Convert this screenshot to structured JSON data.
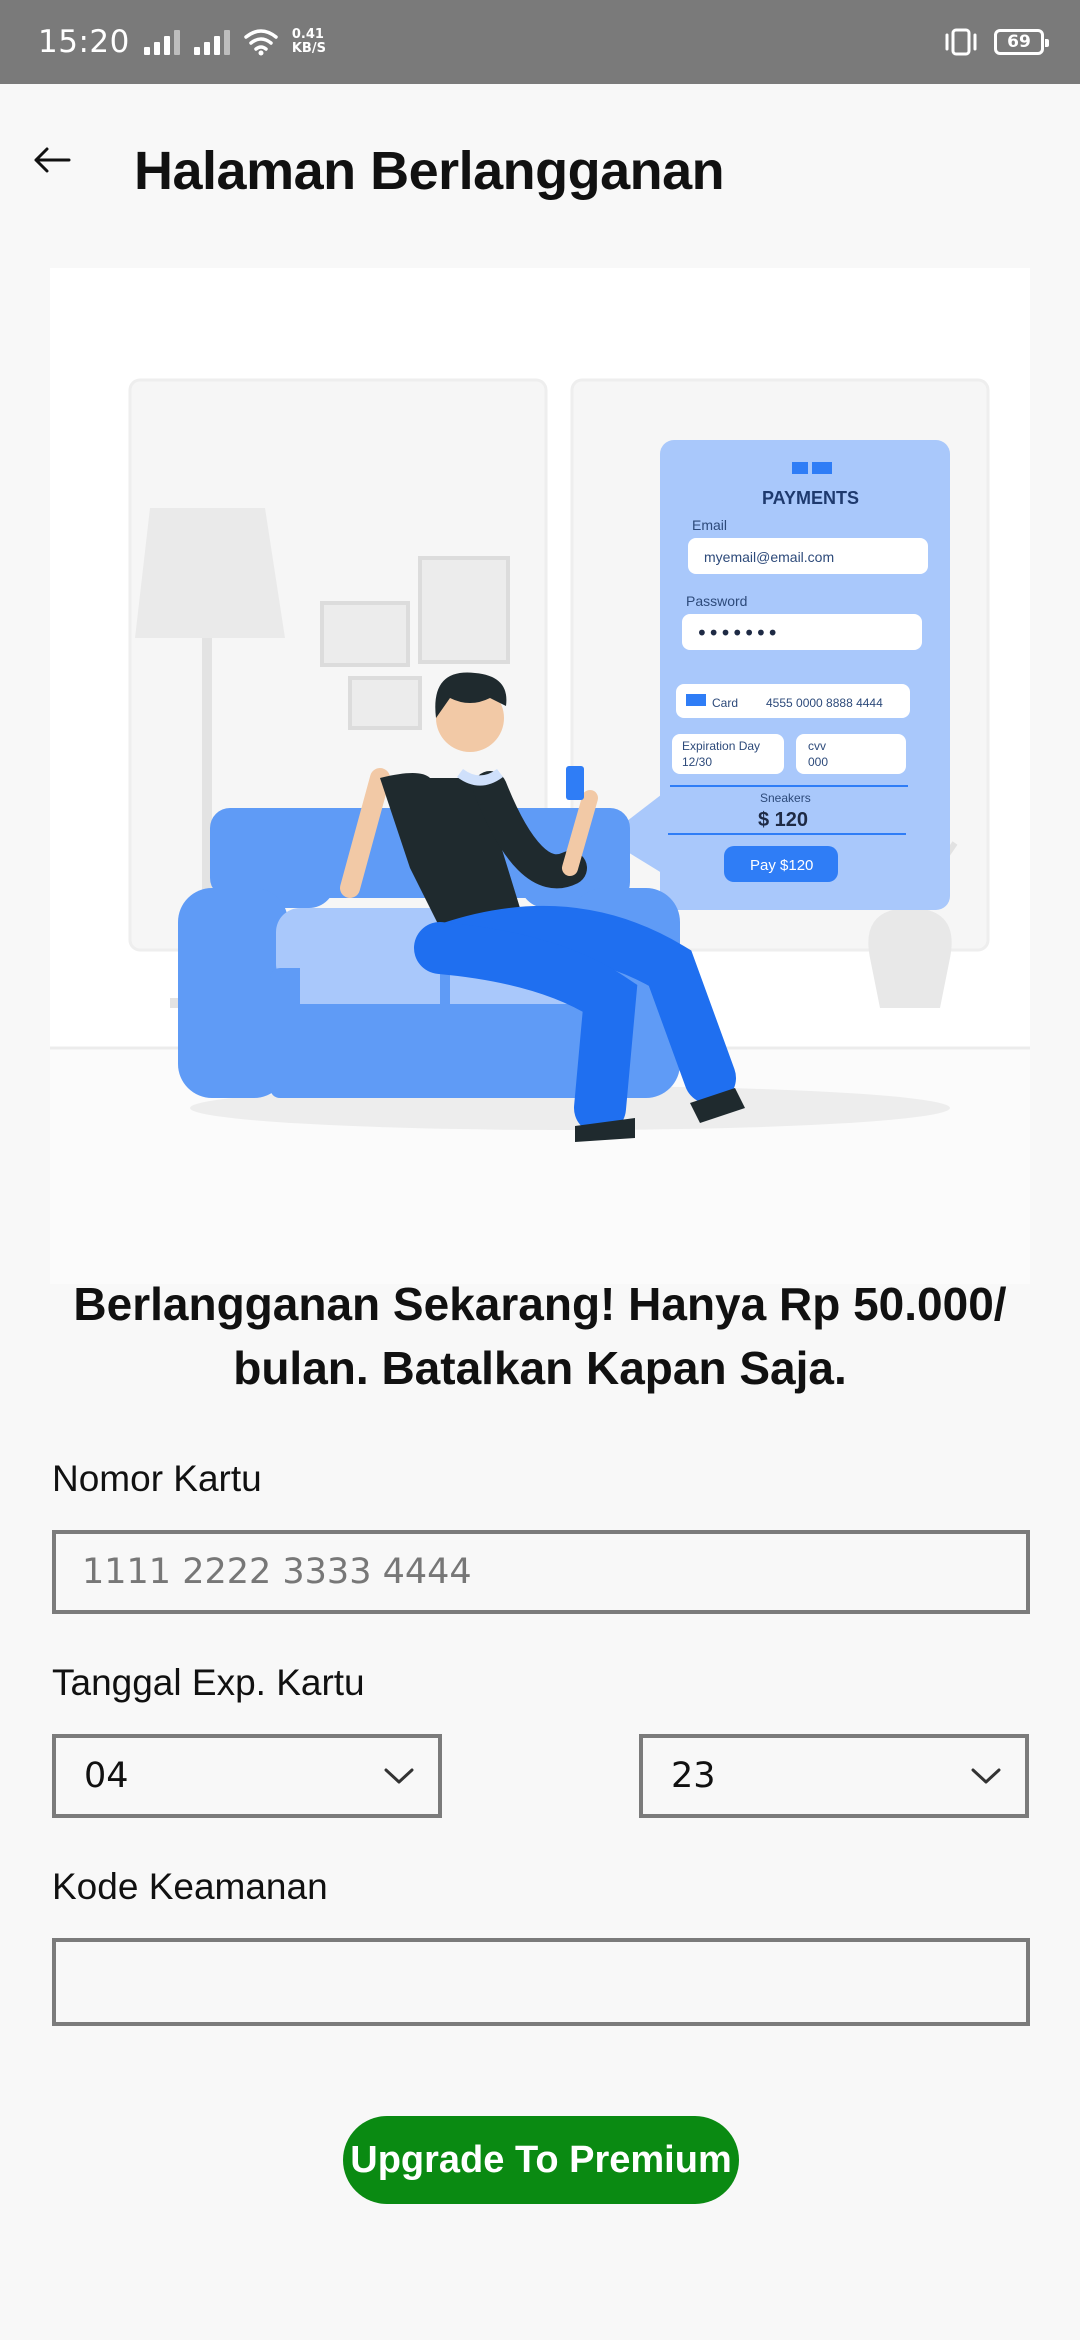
{
  "status_bar": {
    "time": "15:20",
    "net_speed_value": "0.41",
    "net_speed_unit": "KB/S",
    "battery_level": "69"
  },
  "header": {
    "title": "Halaman Berlangganan"
  },
  "illustration": {
    "payments_title": "PAYMENTS",
    "email_label": "Email",
    "email_value": "myemail@email.com",
    "password_label": "Password",
    "password_mask": "•••••••",
    "card_label": "Card",
    "card_number": "4555 0000 8888 4444",
    "exp_label": "Expiration Day",
    "exp_value": "12/30",
    "cvv_label": "cvv",
    "cvv_value": "000",
    "product_label": "Sneakers",
    "product_price": "$ 120",
    "pay_button": "Pay $120"
  },
  "headline": {
    "line1": "Berlangganan Sekarang! Hanya Rp 50.000/",
    "line2": "bulan. Batalkan Kapan Saja."
  },
  "form": {
    "card_number_label": "Nomor Kartu",
    "card_number_placeholder": "1111 2222 3333 4444",
    "card_number_value": "",
    "expiry_label": "Tanggal Exp. Kartu",
    "expiry_month": "04",
    "expiry_year": "23",
    "security_code_label": "Kode Keamanan",
    "security_code_value": ""
  },
  "actions": {
    "upgrade_label": "Upgrade To Premium"
  },
  "colors": {
    "status_bar": "#7a7a7a",
    "background": "#f8f8f8",
    "button": "#0a8a12",
    "illustration_blue": "#2f7df6",
    "illustration_light_blue": "#a9c8fb"
  }
}
